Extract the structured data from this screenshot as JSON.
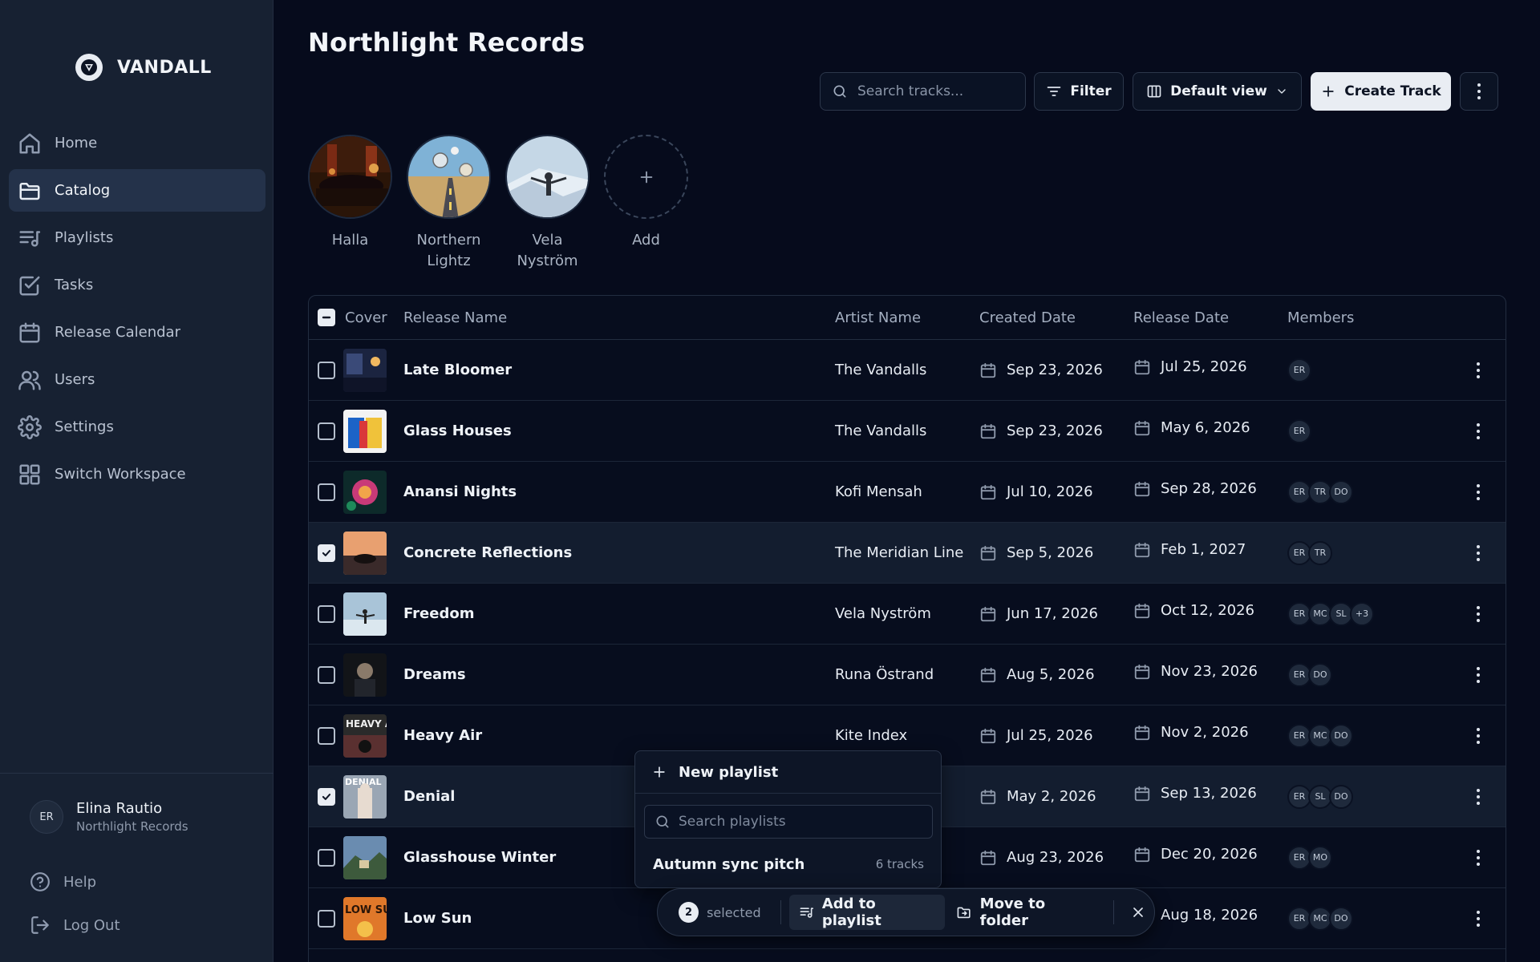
{
  "brand": {
    "name": "VANDALL"
  },
  "nav": [
    {
      "label": "Home",
      "icon": "home-icon"
    },
    {
      "label": "Catalog",
      "icon": "folder-icon",
      "active": true
    },
    {
      "label": "Playlists",
      "icon": "playlist-icon"
    },
    {
      "label": "Tasks",
      "icon": "checkbox-icon"
    },
    {
      "label": "Release Calendar",
      "icon": "calendar-icon"
    },
    {
      "label": "Users",
      "icon": "users-icon"
    },
    {
      "label": "Settings",
      "icon": "gear-icon"
    },
    {
      "label": "Switch Workspace",
      "icon": "grid-icon"
    }
  ],
  "user": {
    "initials": "ER",
    "name": "Elina Rautio",
    "org": "Northlight Records"
  },
  "bottom": {
    "help": "Help",
    "logout": "Log Out"
  },
  "page": {
    "title": "Northlight Records"
  },
  "toolbar": {
    "search_placeholder": "Search tracks...",
    "filter": "Filter",
    "view": "Default view",
    "create": "Create Track"
  },
  "artists": [
    {
      "name": "Halla"
    },
    {
      "name": "Northern Lightz"
    },
    {
      "name": "Vela Nyström"
    },
    {
      "name": "Add"
    }
  ],
  "table": {
    "headers": {
      "cover": "Cover",
      "release": "Release Name",
      "artist": "Artist Name",
      "created": "Created Date",
      "released": "Release Date",
      "members": "Members"
    },
    "rows": [
      {
        "name": "Late Bloomer",
        "artist": "The Vandalls",
        "created": "Sep 23, 2026",
        "release": "Jul 25, 2026",
        "members": [
          "ER"
        ],
        "checked": false
      },
      {
        "name": "Glass Houses",
        "artist": "The Vandalls",
        "created": "Sep 23, 2026",
        "release": "May 6, 2026",
        "members": [
          "ER"
        ],
        "checked": false
      },
      {
        "name": "Anansi Nights",
        "artist": "Kofi Mensah",
        "created": "Jul 10, 2026",
        "release": "Sep 28, 2026",
        "members": [
          "ER",
          "TR",
          "DO"
        ],
        "checked": false
      },
      {
        "name": "Concrete Reflections",
        "artist": "The Meridian Line",
        "created": "Sep 5, 2026",
        "release": "Feb 1, 2027",
        "members": [
          "ER",
          "TR"
        ],
        "checked": true
      },
      {
        "name": "Freedom",
        "artist": "Vela Nyström",
        "created": "Jun 17, 2026",
        "release": "Oct 12, 2026",
        "members": [
          "ER",
          "MC",
          "SL",
          "+3"
        ],
        "checked": false
      },
      {
        "name": "Dreams",
        "artist": "Runa Östrand",
        "created": "Aug 5, 2026",
        "release": "Nov 23, 2026",
        "members": [
          "ER",
          "DO"
        ],
        "checked": false
      },
      {
        "name": "Heavy Air",
        "artist": "Kite Index",
        "created": "Jul 25, 2026",
        "release": "Nov 2, 2026",
        "members": [
          "ER",
          "MC",
          "DO"
        ],
        "checked": false
      },
      {
        "name": "Denial",
        "artist": "",
        "created": "May 2, 2026",
        "release": "Sep 13, 2026",
        "members": [
          "ER",
          "SL",
          "DO"
        ],
        "checked": true
      },
      {
        "name": "Glasshouse Winter",
        "artist": "",
        "created": "Aug 23, 2026",
        "release": "Dec 20, 2026",
        "members": [
          "ER",
          "MO"
        ],
        "checked": false
      },
      {
        "name": "Low Sun",
        "artist": "",
        "created": "",
        "release": "Aug 18, 2026",
        "members": [
          "ER",
          "MC",
          "DO"
        ],
        "checked": false
      }
    ]
  },
  "playlist_menu": {
    "new": "New playlist",
    "search_placeholder": "Search playlists",
    "items": [
      {
        "name": "Autumn sync pitch",
        "count": "6 tracks"
      }
    ]
  },
  "selection_bar": {
    "count": "2",
    "label": "selected",
    "add": "Add to playlist",
    "move": "Move to folder"
  },
  "colors": {
    "background": "#060b1c",
    "sidebar": "#172132",
    "primary_button": "#e9edf3"
  }
}
